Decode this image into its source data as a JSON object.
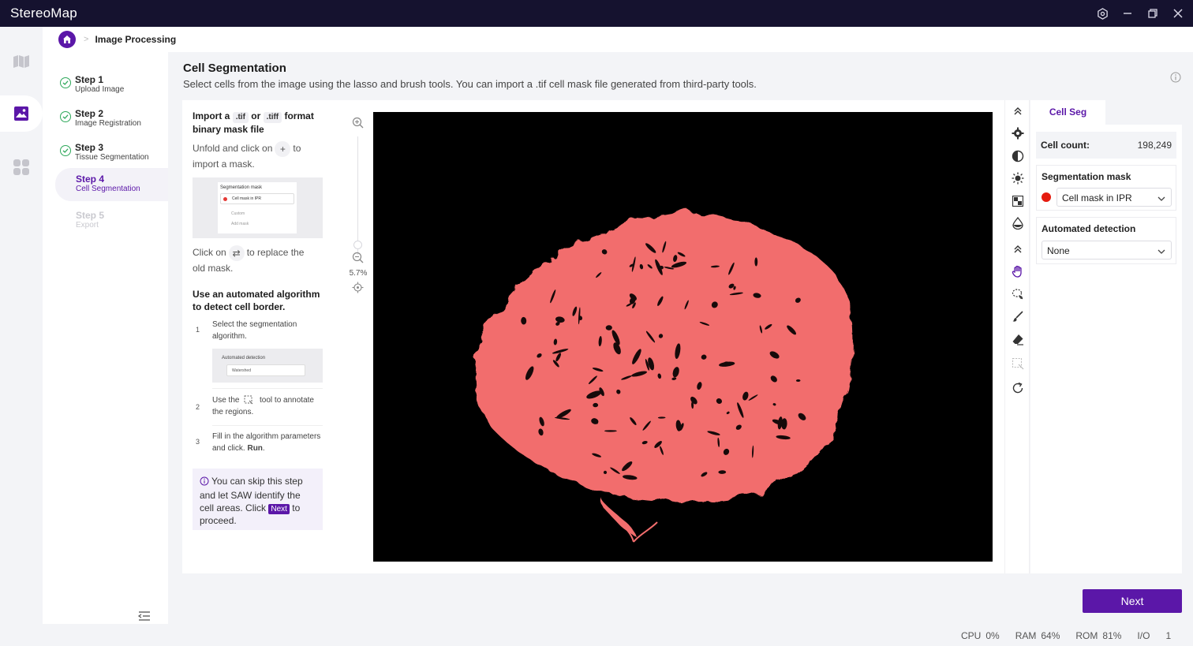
{
  "app": {
    "title": "StereoMap",
    "controls": [
      "settings-icon",
      "minimize-icon",
      "restore-icon",
      "close-icon"
    ]
  },
  "breadcrumb": {
    "page": "Image Processing"
  },
  "steps": [
    {
      "title": "Step 1",
      "subtitle": "Upload Image",
      "state": "done"
    },
    {
      "title": "Step 2",
      "subtitle": "Image Registration",
      "state": "done"
    },
    {
      "title": "Step 3",
      "subtitle": "Tissue Segmentation",
      "state": "done"
    },
    {
      "title": "Step 4",
      "subtitle": "Cell Segmentation",
      "state": "active"
    },
    {
      "title": "Step 5",
      "subtitle": "Export",
      "state": "disabled"
    }
  ],
  "main": {
    "title": "Cell Segmentation",
    "description": "Select cells from the image using the lasso and brush tools. You can import a .tif cell mask file generated from third-party tools."
  },
  "guide": {
    "import_pre": "Import a",
    "tif": ".tif",
    "or": "or",
    "tiff": ".tiff",
    "import_post": "format",
    "import_line2": "binary mask file",
    "unfold_pre": "Unfold and click on",
    "unfold_icon": "+",
    "unfold_post": "to",
    "unfold_line2": "import a mask.",
    "mini": {
      "title": "Segmentation mask",
      "selected": "Cell mask in IPR",
      "custom": "Custom",
      "add": "Add mask"
    },
    "replace_pre": "Click on",
    "replace_icon": "⇄",
    "replace_post": "to replace the",
    "replace_line2": "old mask.",
    "auto_head": "Use an automated algorithm to detect cell border.",
    "list": [
      {
        "num": "1",
        "text": "Select the segmentation algorithm."
      },
      {
        "num": "2",
        "text_pre": "Use the",
        "text_post": "tool to annotate the regions."
      },
      {
        "num": "3",
        "text_pre": "Fill in the algorithm parameters and click.",
        "bold": "Run"
      }
    ],
    "mini2": {
      "title": "Automated detection",
      "selected": "Watershed"
    },
    "tip": {
      "pre": "You can skip this step and let SAW identify the cell areas. Click",
      "chip": "Next",
      "post": "to proceed."
    }
  },
  "viewer": {
    "zoom": "5.7%",
    "tissue_color": "#f26d6d",
    "background": "#000000"
  },
  "right_panel": {
    "tab": "Cell Seg",
    "cell_count_label": "Cell count:",
    "cell_count_value": "198,249",
    "seg_mask_title": "Segmentation mask",
    "seg_mask_value": "Cell mask in IPR",
    "auto_title": "Automated detection",
    "auto_value": "None"
  },
  "actions": {
    "next": "Next"
  },
  "status": {
    "cpu_label": "CPU",
    "cpu_value": "0%",
    "ram_label": "RAM",
    "ram_value": "64%",
    "rom_label": "ROM",
    "rom_value": "81%",
    "io_label": "I/O",
    "io_value": "1"
  },
  "colors": {
    "accent": "#5b17a8",
    "titlebar": "#15122f",
    "success": "#2ea85a"
  }
}
